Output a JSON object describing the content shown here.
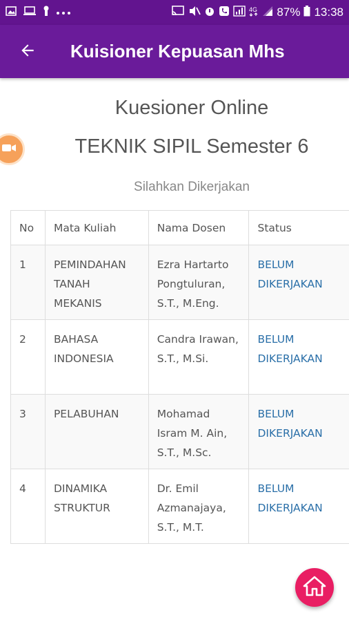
{
  "status_bar": {
    "battery": "87%",
    "time": "13:38",
    "signal_label": "4G"
  },
  "app_bar": {
    "title": "Kuisioner Kepuasan Mhs"
  },
  "content": {
    "heading": "Kuesioner Online",
    "program": "TEKNIK SIPIL Semester 6",
    "instruction": "Silahkan Dikerjakan"
  },
  "table": {
    "headers": [
      "No",
      "Mata Kuliah",
      "Nama Dosen",
      "Status"
    ],
    "rows": [
      {
        "no": "1",
        "mata_kuliah": "PEMINDAHAN TANAH MEKANIS",
        "dosen": "Ezra Hartarto Pongtuluran, S.T., M.Eng.",
        "status": "BELUM DIKERJAKAN"
      },
      {
        "no": "2",
        "mata_kuliah": "BAHASA INDONESIA",
        "dosen": "Candra Irawan, S.T., M.Si.",
        "status": "BELUM DIKERJAKAN"
      },
      {
        "no": "3",
        "mata_kuliah": "PELABUHAN",
        "dosen": "Mohamad Isram M. Ain, S.T., M.Sc.",
        "status": "BELUM DIKERJAKAN"
      },
      {
        "no": "4",
        "mata_kuliah": "DINAMIKA STRUKTUR",
        "dosen": "Dr. Emil Azmanajaya, S.T., M.T.",
        "status": "BELUM DIKERJAKAN"
      }
    ]
  },
  "colors": {
    "status_bar": "#62148f",
    "app_bar": "#6a1b9a",
    "status_link": "#2a6fa8",
    "home_fab": "#e91e63",
    "side_toggle": "#f6a15a"
  },
  "icons": {
    "back": "arrow-back-icon",
    "home": "home-icon",
    "side_toggle": "video-camera-icon"
  }
}
